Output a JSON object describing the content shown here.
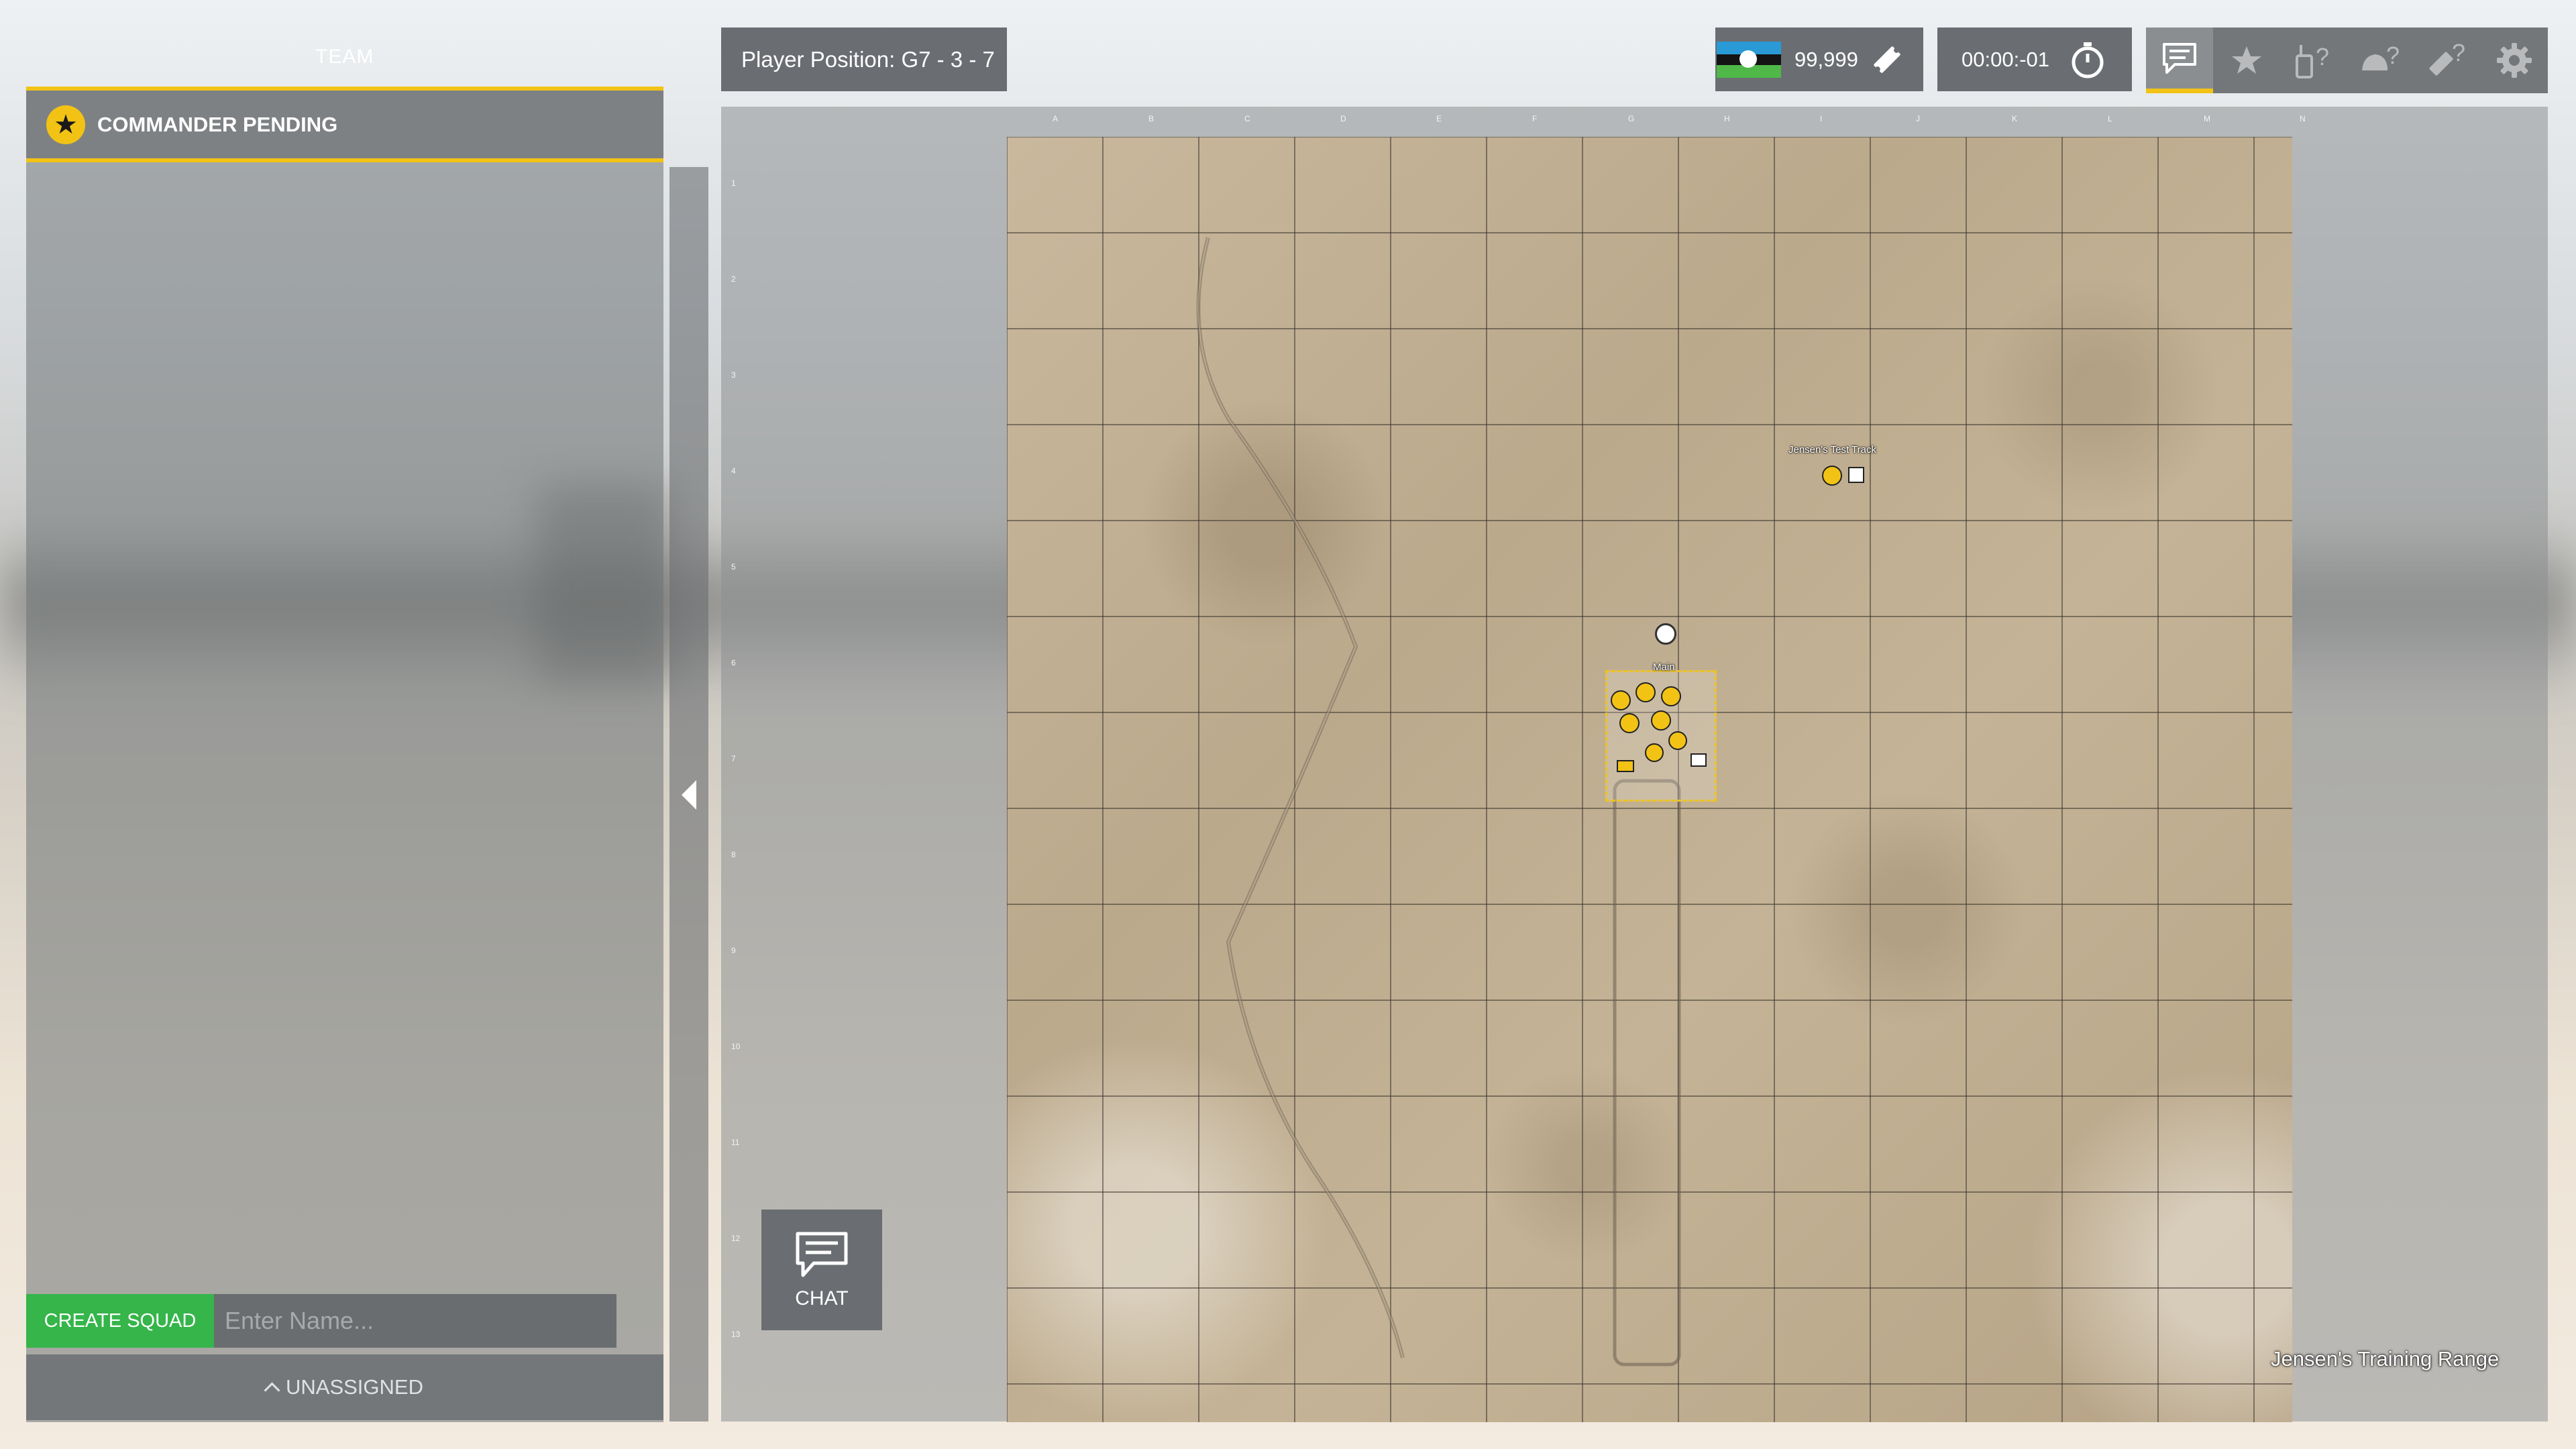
{
  "left_panel": {
    "team_tab": "TEAM",
    "commander_label": "COMMANDER PENDING",
    "create_squad_label": "CREATE SQUAD",
    "squad_name_placeholder": "Enter Name...",
    "unassigned_label": "UNASSIGNED"
  },
  "top_bar": {
    "player_position": "Player Position: G7 - 3 - 7",
    "tickets": "99,999",
    "timer": "00:00:-01"
  },
  "toolbar": {
    "items": [
      {
        "icon": "chat-icon",
        "active": true
      },
      {
        "icon": "star-icon",
        "active": false
      },
      {
        "icon": "radio-query-icon",
        "active": false
      },
      {
        "icon": "helmet-query-icon",
        "active": false
      },
      {
        "icon": "ticket-query-icon",
        "active": false
      },
      {
        "icon": "gear-icon",
        "active": false
      }
    ]
  },
  "map": {
    "name": "Jensen's Training Range",
    "columns": [
      "A",
      "B",
      "C",
      "D",
      "E",
      "F",
      "G",
      "H",
      "I",
      "J",
      "K",
      "L",
      "M",
      "N"
    ],
    "rows": [
      "1",
      "2",
      "3",
      "4",
      "5",
      "6",
      "7",
      "8",
      "9",
      "10",
      "11",
      "12",
      "13"
    ],
    "markers": {
      "north_label": "Jensen's Test Track",
      "main_label": "Main"
    }
  },
  "chat_button": {
    "label": "CHAT"
  },
  "colors": {
    "accent": "#f2c314",
    "create_squad": "#35b54a",
    "panel": "#6a6d71"
  }
}
